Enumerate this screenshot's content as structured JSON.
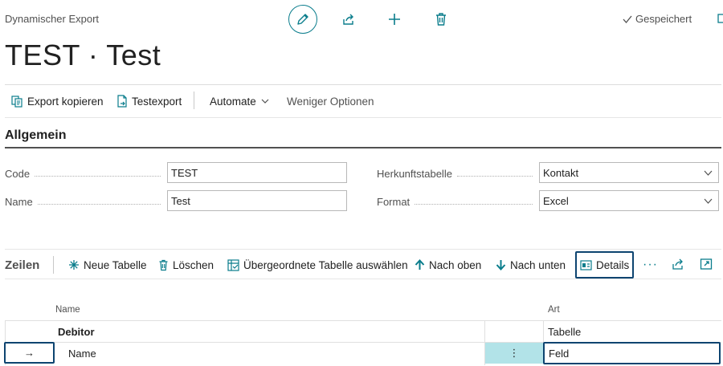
{
  "header": {
    "caption": "Dynamischer Export",
    "title": "TEST · Test",
    "saved_label": "Gespeichert",
    "icons": [
      "pencil-icon",
      "share-icon",
      "plus-icon",
      "trash-icon",
      "check-icon"
    ]
  },
  "actions": {
    "copy_export": "Export kopieren",
    "test_export": "Testexport",
    "automate": "Automate",
    "fewer_options": "Weniger Optionen"
  },
  "general": {
    "section_title": "Allgemein",
    "code_label": "Code",
    "code_value": "TEST",
    "name_label": "Name",
    "name_value": "Test",
    "source_table_label": "Herkunftstabelle",
    "source_table_value": "Kontakt",
    "format_label": "Format",
    "format_value": "Excel"
  },
  "lines": {
    "section_title": "Zeilen",
    "new_table": "Neue Tabelle",
    "delete": "Löschen",
    "select_parent": "Übergeordnete Tabelle auswählen",
    "move_up": "Nach oben",
    "move_down": "Nach unten",
    "details": "Details",
    "columns": {
      "name": "Name",
      "type": "Art"
    },
    "rows": [
      {
        "name": "Debitor",
        "type": "Tabelle",
        "bold": true
      },
      {
        "name": "Name",
        "type": "Feld",
        "bold": false
      }
    ],
    "row_marker": "→",
    "row_menu": "⋮"
  },
  "colors": {
    "accent": "#0a7d8c",
    "focus": "#0d4470",
    "selected": "#b2e3e8"
  }
}
